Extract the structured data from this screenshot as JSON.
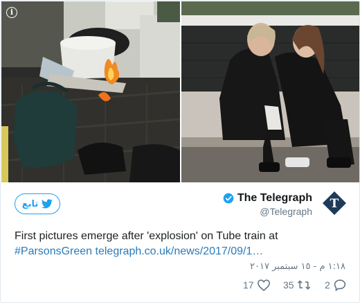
{
  "tweet": {
    "account": {
      "display_name": "The Telegraph",
      "screen_name": "@Telegraph",
      "verified": true
    },
    "follow_label": "تابع",
    "text_plain": "First pictures emerge after 'explosion' on Tube train at",
    "hashtag": "#ParsonsGreen",
    "link": "telegraph.co.uk/news/2017/09/1…",
    "timestamp": "١:١٨ م - ١٥ سبتمبر ٢٠١٧",
    "stats": {
      "likes": "17",
      "retweets": "35",
      "replies": "2"
    }
  },
  "icons": {
    "info": "info-icon",
    "twitter": "twitter-bird-icon",
    "verified": "verified-badge-icon",
    "like": "heart-icon",
    "retweet": "retweet-icon",
    "reply": "reply-icon"
  },
  "colors": {
    "brand": "#1da1f2",
    "link": "#2b7bb9",
    "muted": "#657786",
    "text": "#1c2022"
  }
}
